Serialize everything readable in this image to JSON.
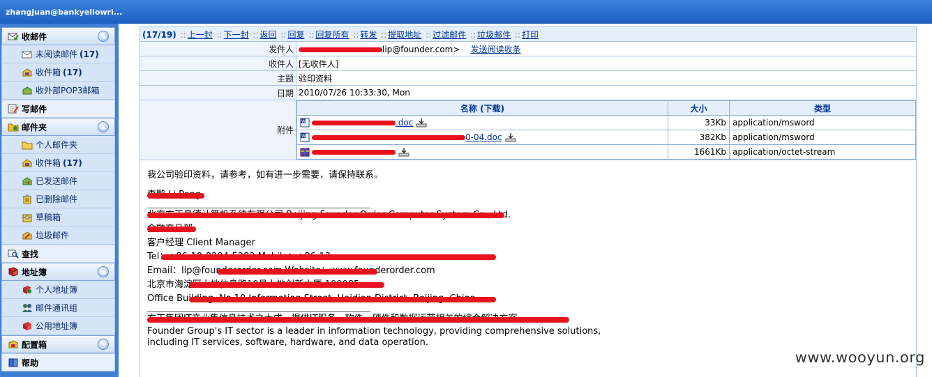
{
  "topbar": {
    "user": "zhangjuan@bankyellowri..."
  },
  "sidebar": {
    "inbox_section": {
      "label": "收邮件",
      "icon": "mail-check-icon"
    },
    "inbox_items": [
      {
        "label": "未阅读邮件",
        "count": "(17)",
        "icon": "envelope-icon"
      },
      {
        "label": "收件箱",
        "count": "(17)",
        "icon": "inbox-icon"
      },
      {
        "label": "收外部POP3邮箱",
        "count": "",
        "icon": "pop3-icon"
      }
    ],
    "compose": {
      "label": "写邮件",
      "icon": "compose-icon"
    },
    "folder_section": {
      "label": "邮件夹",
      "icon": "folder-icon"
    },
    "folder_items": [
      {
        "label": "个人邮件夹",
        "count": "",
        "icon": "folder-icon"
      },
      {
        "label": "收件箱",
        "count": "(17)",
        "icon": "inbox-icon"
      },
      {
        "label": "已发送邮件",
        "count": "",
        "icon": "sent-icon"
      },
      {
        "label": "已删除邮件",
        "count": "",
        "icon": "trash-icon"
      },
      {
        "label": "草稿箱",
        "count": "",
        "icon": "drafts-icon"
      },
      {
        "label": "垃圾邮件",
        "count": "",
        "icon": "spam-icon"
      }
    ],
    "search": {
      "label": "查找",
      "icon": "search-icon"
    },
    "addressbook_section": {
      "label": "地址簿",
      "icon": "addressbook-icon"
    },
    "addressbook_items": [
      {
        "label": "个人地址簿",
        "icon": "contact-icon"
      },
      {
        "label": "邮件通讯组",
        "icon": "group-icon"
      },
      {
        "label": "公用地址簿",
        "icon": "public-contacts-icon"
      }
    ],
    "config_section": {
      "label": "配置箱",
      "icon": "config-icon"
    },
    "help": {
      "label": "帮助",
      "icon": "help-icon"
    }
  },
  "toolbar": {
    "count": "(17/19)",
    "actions": [
      "上一封",
      "下一封",
      "返回",
      "回复",
      "回复所有",
      "转发",
      "提取地址",
      "过滤邮件",
      "垃圾邮件",
      "打印"
    ]
  },
  "header": {
    "from_label": "发件人",
    "from_value": "lip@founder.com>",
    "receipt_link": "发送阅读收条",
    "to_label": "收件人",
    "to_value": "[无收件人]",
    "subject_label": "主题",
    "subject_value": "验印资料",
    "date_label": "日期",
    "date_value": "2010/07/26 10:33:30, Mon",
    "attach_label": "附件"
  },
  "attachments": {
    "col_name": "名称 (下载)",
    "col_size": "大小",
    "col_type": "类型",
    "rows": [
      {
        "name": ".doc",
        "size": "33Kb",
        "type": "application/msword",
        "icon": "word-icon"
      },
      {
        "name": "0-04.doc",
        "size": "382Kb",
        "type": "application/msword",
        "icon": "word-icon"
      },
      {
        "name": "",
        "size": "1661Kb",
        "type": "application/octet-stream",
        "icon": "archive-icon"
      }
    ]
  },
  "body": {
    "greeting": "我公司验印资料，请参考，如有进一步需要，请保持联系。",
    "signature_lines": [
      "李鹏 Li Peng",
      "北京方正奥德计算机系统有限公司 Beijing Founder Order Computer System Co., Ltd.",
      "金融产品部",
      "客户经理 Client Manager",
      "Tel：+86-10-8284-5283 Mobile：+86-13",
      "Email：lip@founderorder.com Website：www.founderorder.com",
      "北京市海淀区上地信息路10号上地创新大厦 100085",
      "Office Building, No.10 Information Street, Haidian District, Beijing, China."
    ],
    "footer_cn": "方正集团IT产业集信息技术之大成，提供IT服务、软件、硬件和数据运营相关的综合解决方案。",
    "footer_en_1": "Founder Group's IT sector is a leader in information technology, providing comprehensive solutions,",
    "footer_en_2": "including IT services, software, hardware, and data operation."
  },
  "watermark": "www.wooyun.org"
}
